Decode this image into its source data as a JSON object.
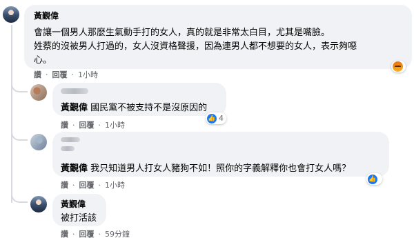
{
  "comments": [
    {
      "author": "黃覲偉",
      "lines": [
        "會讓一個男人那麼生氣動手打的女人，真的就是非常太白目，尤其是嘴臉。",
        "姓蔡的沒被男人打過的，女人沒資格聲援，因為連男人都不想要的女人，表示夠噁",
        "心。"
      ],
      "actions": {
        "like": "讚",
        "reply": "回覆",
        "time": "1小時"
      },
      "reaction": {
        "icon": "angry-icon",
        "count": ""
      }
    },
    {
      "author": "",
      "mention": "黃覲偉",
      "text": "國民黨不被支持不是沒原因的",
      "actions": {
        "like": "讚",
        "reply": "回覆",
        "time": "1小時"
      },
      "reaction": {
        "icon": "like-icon",
        "count": "4"
      }
    },
    {
      "author": "",
      "mention": "黃覲偉",
      "text": "我只知道男人打女人豬狗不如！照你的字義解釋你也會打女人嗎？",
      "actions": {
        "like": "讚",
        "reply": "回覆",
        "time": "1小時"
      },
      "reaction": {
        "icon": "like-icon",
        "count": ""
      }
    },
    {
      "author": "黃覲偉",
      "text": "被打活該",
      "actions": {
        "like": "讚",
        "reply": "回覆",
        "time": "59分鐘"
      }
    }
  ],
  "colors": {
    "bubble": "#f0f2f5",
    "meta": "#65676b",
    "like": "#1877f2"
  }
}
